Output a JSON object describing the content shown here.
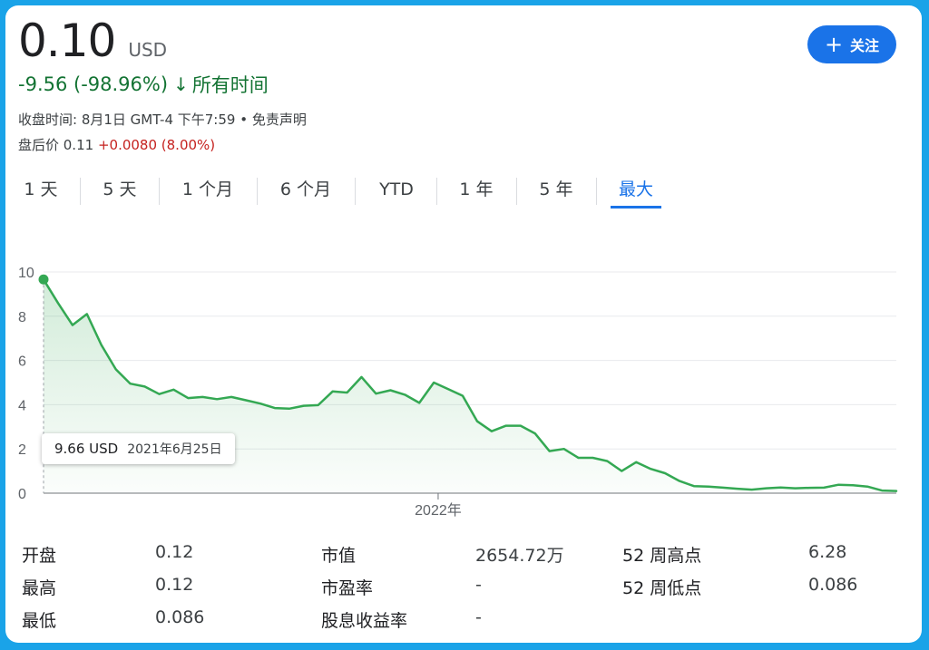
{
  "header": {
    "price": "0.10",
    "currency": "USD",
    "change": "-9.56 (-98.96%)",
    "change_arrow": "↓",
    "period": "所有时间",
    "close_info": "收盘时间: 8月1日 GMT-4 下午7:59 • 免责声明",
    "after_hours_label": "盘后价 0.11",
    "after_hours_change": "+0.0080 (8.00%)",
    "follow_label": "关注"
  },
  "tabs": [
    {
      "label": "1 天"
    },
    {
      "label": "5 天"
    },
    {
      "label": "1 个月"
    },
    {
      "label": "6 个月"
    },
    {
      "label": "YTD"
    },
    {
      "label": "1 年"
    },
    {
      "label": "5 年"
    },
    {
      "label": "最大",
      "active": true
    }
  ],
  "tooltip": {
    "value": "9.66 USD",
    "date": "2021年6月25日"
  },
  "stats": {
    "col1": [
      {
        "label": "开盘",
        "value": "0.12"
      },
      {
        "label": "最高",
        "value": "0.12"
      },
      {
        "label": "最低",
        "value": "0.086"
      }
    ],
    "col2": [
      {
        "label": "市值",
        "value": "2654.72万"
      },
      {
        "label": "市盈率",
        "value": "-"
      },
      {
        "label": "股息收益率",
        "value": "-"
      }
    ],
    "col3": [
      {
        "label": "52 周高点",
        "value": "6.28"
      },
      {
        "label": "52 周低点",
        "value": "0.086"
      }
    ]
  },
  "colors": {
    "line": "#34a853",
    "accent": "#1a73e8",
    "down": "#137333",
    "up": "#c5221f"
  },
  "chart_data": {
    "type": "area",
    "ylim": [
      0,
      10
    ],
    "yticks": [
      0,
      2,
      4,
      6,
      8,
      10
    ],
    "xticks": [
      {
        "label": "2022年",
        "x": 27.3
      }
    ],
    "x_range": [
      0,
      59
    ],
    "grid": true,
    "series": [
      {
        "values": [
          9.66,
          8.6,
          7.6,
          8.1,
          6.7,
          5.6,
          4.95,
          4.82,
          4.48,
          4.68,
          4.3,
          4.35,
          4.25,
          4.35,
          4.2,
          4.05,
          3.85,
          3.82,
          3.95,
          3.98,
          4.6,
          4.55,
          5.25,
          4.5,
          4.65,
          4.45,
          4.08,
          5.0,
          4.7,
          4.4,
          3.25,
          2.8,
          3.05,
          3.05,
          2.7,
          1.9,
          2.0,
          1.6,
          1.6,
          1.45,
          1.0,
          1.4,
          1.1,
          0.9,
          0.55,
          0.32,
          0.3,
          0.25,
          0.2,
          0.16,
          0.22,
          0.26,
          0.22,
          0.24,
          0.25,
          0.38,
          0.36,
          0.3,
          0.12,
          0.1
        ]
      }
    ],
    "highlight_point": {
      "index": 0,
      "value": 9.66
    }
  }
}
